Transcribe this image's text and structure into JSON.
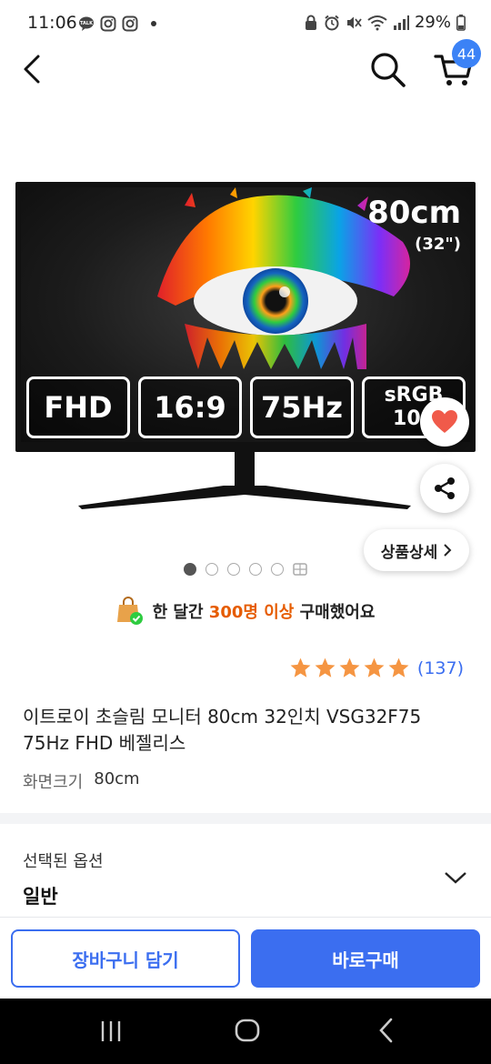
{
  "status_bar": {
    "time": "11:06",
    "battery": "29%"
  },
  "header": {
    "cart_count": "44"
  },
  "product_image": {
    "size_main": "80cm",
    "size_sub": "(32\")",
    "specs": [
      "FHD",
      "16:9",
      "75Hz",
      "sRGB 100"
    ],
    "pager": {
      "total": 5,
      "active": 0
    }
  },
  "detail_button": {
    "label": "상품상세"
  },
  "purchase_banner": {
    "prefix": "한 달간",
    "highlight": "300명 이상",
    "suffix": "구매했어요"
  },
  "rating": {
    "stars": 5,
    "count": "(137)"
  },
  "product": {
    "title": "이트로이 초슬림 모니터 80cm 32인치 VSG32F75 75Hz FHD 베젤리스",
    "spec_label": "화면크기",
    "spec_value": "80cm"
  },
  "option": {
    "label": "선택된 옵션",
    "value": "일반"
  },
  "bottom": {
    "cart_label": "장바구니 담기",
    "buy_label": "바로구매"
  },
  "colors": {
    "accent": "#3b6ef0",
    "highlight": "#e65c00",
    "badge": "#3b82f6",
    "heart": "#f05a4a"
  }
}
